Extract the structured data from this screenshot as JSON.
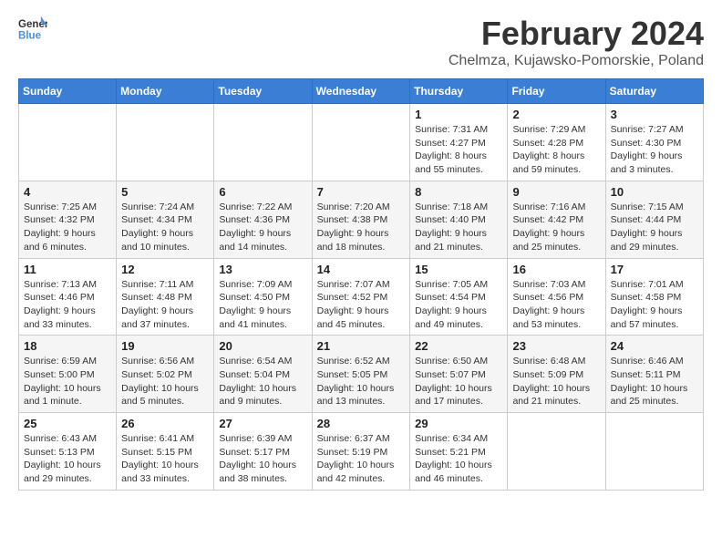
{
  "logo": {
    "line1": "General",
    "line2": "Blue"
  },
  "title": "February 2024",
  "subtitle": "Chelmza, Kujawsko-Pomorskie, Poland",
  "headers": [
    "Sunday",
    "Monday",
    "Tuesday",
    "Wednesday",
    "Thursday",
    "Friday",
    "Saturday"
  ],
  "weeks": [
    [
      {
        "day": "",
        "info": ""
      },
      {
        "day": "",
        "info": ""
      },
      {
        "day": "",
        "info": ""
      },
      {
        "day": "",
        "info": ""
      },
      {
        "day": "1",
        "info": "Sunrise: 7:31 AM\nSunset: 4:27 PM\nDaylight: 8 hours\nand 55 minutes."
      },
      {
        "day": "2",
        "info": "Sunrise: 7:29 AM\nSunset: 4:28 PM\nDaylight: 8 hours\nand 59 minutes."
      },
      {
        "day": "3",
        "info": "Sunrise: 7:27 AM\nSunset: 4:30 PM\nDaylight: 9 hours\nand 3 minutes."
      }
    ],
    [
      {
        "day": "4",
        "info": "Sunrise: 7:25 AM\nSunset: 4:32 PM\nDaylight: 9 hours\nand 6 minutes."
      },
      {
        "day": "5",
        "info": "Sunrise: 7:24 AM\nSunset: 4:34 PM\nDaylight: 9 hours\nand 10 minutes."
      },
      {
        "day": "6",
        "info": "Sunrise: 7:22 AM\nSunset: 4:36 PM\nDaylight: 9 hours\nand 14 minutes."
      },
      {
        "day": "7",
        "info": "Sunrise: 7:20 AM\nSunset: 4:38 PM\nDaylight: 9 hours\nand 18 minutes."
      },
      {
        "day": "8",
        "info": "Sunrise: 7:18 AM\nSunset: 4:40 PM\nDaylight: 9 hours\nand 21 minutes."
      },
      {
        "day": "9",
        "info": "Sunrise: 7:16 AM\nSunset: 4:42 PM\nDaylight: 9 hours\nand 25 minutes."
      },
      {
        "day": "10",
        "info": "Sunrise: 7:15 AM\nSunset: 4:44 PM\nDaylight: 9 hours\nand 29 minutes."
      }
    ],
    [
      {
        "day": "11",
        "info": "Sunrise: 7:13 AM\nSunset: 4:46 PM\nDaylight: 9 hours\nand 33 minutes."
      },
      {
        "day": "12",
        "info": "Sunrise: 7:11 AM\nSunset: 4:48 PM\nDaylight: 9 hours\nand 37 minutes."
      },
      {
        "day": "13",
        "info": "Sunrise: 7:09 AM\nSunset: 4:50 PM\nDaylight: 9 hours\nand 41 minutes."
      },
      {
        "day": "14",
        "info": "Sunrise: 7:07 AM\nSunset: 4:52 PM\nDaylight: 9 hours\nand 45 minutes."
      },
      {
        "day": "15",
        "info": "Sunrise: 7:05 AM\nSunset: 4:54 PM\nDaylight: 9 hours\nand 49 minutes."
      },
      {
        "day": "16",
        "info": "Sunrise: 7:03 AM\nSunset: 4:56 PM\nDaylight: 9 hours\nand 53 minutes."
      },
      {
        "day": "17",
        "info": "Sunrise: 7:01 AM\nSunset: 4:58 PM\nDaylight: 9 hours\nand 57 minutes."
      }
    ],
    [
      {
        "day": "18",
        "info": "Sunrise: 6:59 AM\nSunset: 5:00 PM\nDaylight: 10 hours\nand 1 minute."
      },
      {
        "day": "19",
        "info": "Sunrise: 6:56 AM\nSunset: 5:02 PM\nDaylight: 10 hours\nand 5 minutes."
      },
      {
        "day": "20",
        "info": "Sunrise: 6:54 AM\nSunset: 5:04 PM\nDaylight: 10 hours\nand 9 minutes."
      },
      {
        "day": "21",
        "info": "Sunrise: 6:52 AM\nSunset: 5:05 PM\nDaylight: 10 hours\nand 13 minutes."
      },
      {
        "day": "22",
        "info": "Sunrise: 6:50 AM\nSunset: 5:07 PM\nDaylight: 10 hours\nand 17 minutes."
      },
      {
        "day": "23",
        "info": "Sunrise: 6:48 AM\nSunset: 5:09 PM\nDaylight: 10 hours\nand 21 minutes."
      },
      {
        "day": "24",
        "info": "Sunrise: 6:46 AM\nSunset: 5:11 PM\nDaylight: 10 hours\nand 25 minutes."
      }
    ],
    [
      {
        "day": "25",
        "info": "Sunrise: 6:43 AM\nSunset: 5:13 PM\nDaylight: 10 hours\nand 29 minutes."
      },
      {
        "day": "26",
        "info": "Sunrise: 6:41 AM\nSunset: 5:15 PM\nDaylight: 10 hours\nand 33 minutes."
      },
      {
        "day": "27",
        "info": "Sunrise: 6:39 AM\nSunset: 5:17 PM\nDaylight: 10 hours\nand 38 minutes."
      },
      {
        "day": "28",
        "info": "Sunrise: 6:37 AM\nSunset: 5:19 PM\nDaylight: 10 hours\nand 42 minutes."
      },
      {
        "day": "29",
        "info": "Sunrise: 6:34 AM\nSunset: 5:21 PM\nDaylight: 10 hours\nand 46 minutes."
      },
      {
        "day": "",
        "info": ""
      },
      {
        "day": "",
        "info": ""
      }
    ]
  ]
}
